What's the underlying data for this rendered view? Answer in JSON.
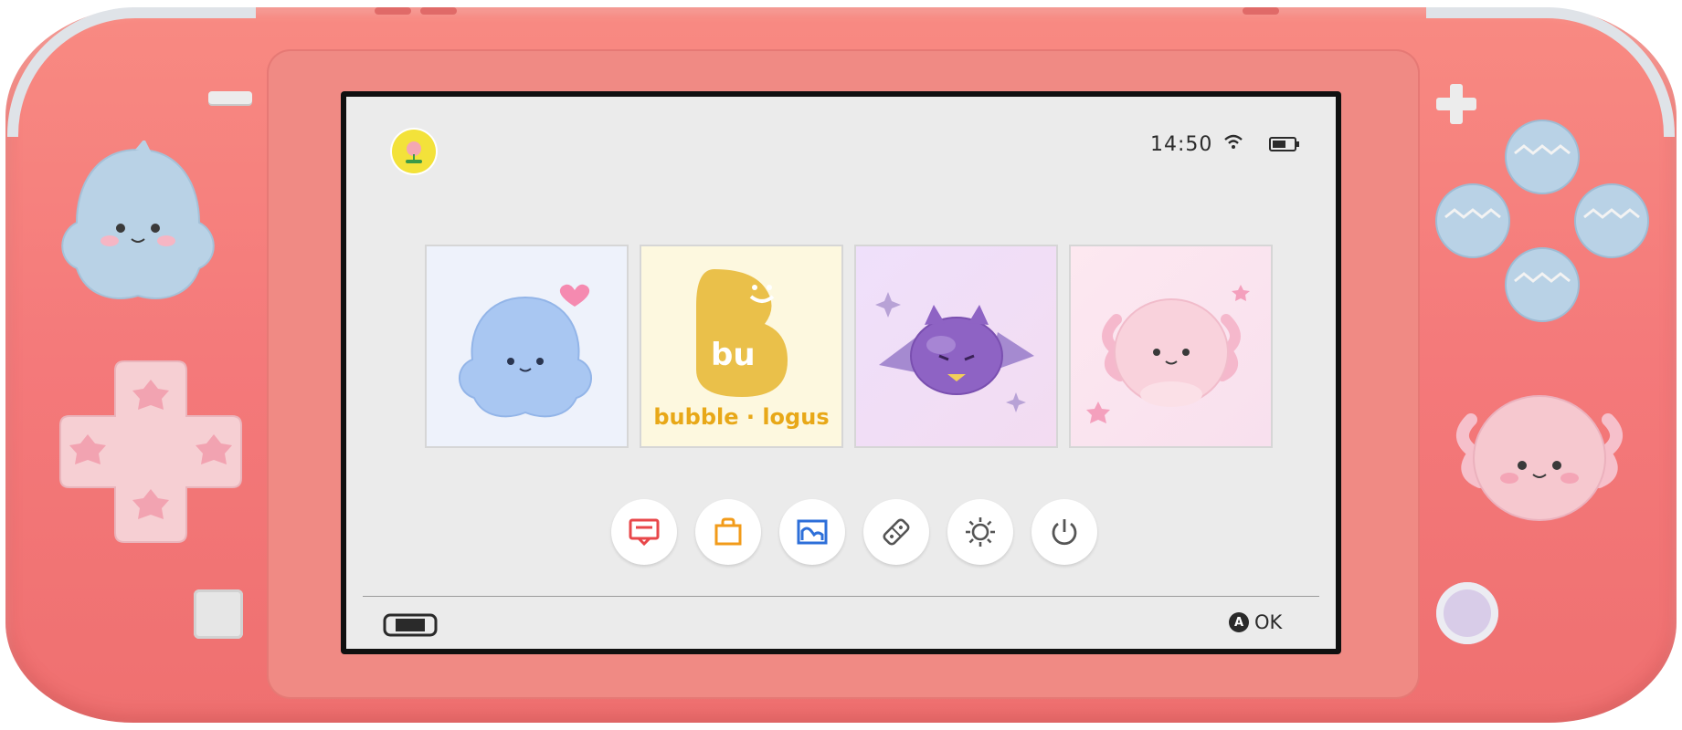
{
  "device": {
    "name": "",
    "body_color": "#f4797a"
  },
  "status_bar": {
    "time": "14:50",
    "wifi_icon": "wifi-icon",
    "battery_icon": "battery-icon",
    "user_icon": "user-avatar-icon"
  },
  "game_tiles": [
    {
      "name": "ghost-game-tile",
      "icon": "blue-ghost-icon"
    },
    {
      "name": "bubble-logus-tile",
      "icon": "bubble-logus-logo",
      "text": "bubble · logus",
      "logo_text": "bu"
    },
    {
      "name": "bat-game-tile",
      "icon": "purple-bat-icon"
    },
    {
      "name": "axolotl-game-tile",
      "icon": "pink-axolotl-icon"
    }
  ],
  "dock": [
    {
      "name": "news-button",
      "icon": "news-icon",
      "color": "#e8474a"
    },
    {
      "name": "eshop-button",
      "icon": "shopping-bag-icon",
      "color": "#f29b1a"
    },
    {
      "name": "album-button",
      "icon": "album-icon",
      "color": "#2d6fd9"
    },
    {
      "name": "controllers-button",
      "icon": "controller-icon",
      "color": "#555555"
    },
    {
      "name": "settings-button",
      "icon": "gear-icon",
      "color": "#555555"
    },
    {
      "name": "power-button",
      "icon": "power-icon",
      "color": "#555555"
    }
  ],
  "footer": {
    "console_icon": "handheld-console-icon",
    "a_button": "A",
    "ok_label": "OK"
  },
  "colors": {
    "screen_bg": "#ebebeb",
    "accent_yellow": "#e8a818",
    "thumbstick_blue": "#b9d2e6",
    "thumbstick_pink": "#f6c8cf"
  }
}
